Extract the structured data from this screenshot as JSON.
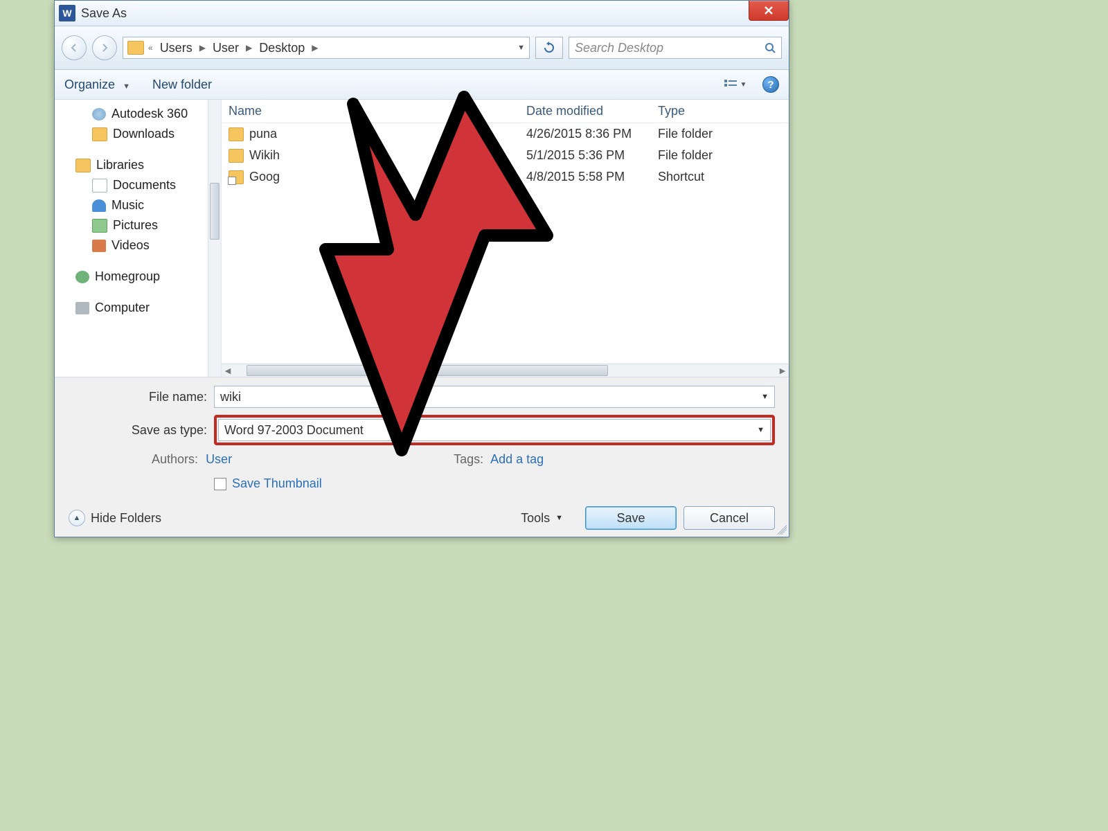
{
  "window": {
    "title": "Save As"
  },
  "breadcrumb": {
    "prefix": "«",
    "items": [
      "Users",
      "User",
      "Desktop"
    ]
  },
  "search": {
    "placeholder": "Search Desktop"
  },
  "toolbar": {
    "organize": "Organize",
    "newfolder": "New folder"
  },
  "sidebar": {
    "items": [
      {
        "label": "Autodesk 360",
        "icon": "cloud",
        "indent": 1
      },
      {
        "label": "Downloads",
        "icon": "dl",
        "indent": 1
      },
      {
        "sep": true
      },
      {
        "label": "Libraries",
        "icon": "lib",
        "indent": 0
      },
      {
        "label": "Documents",
        "icon": "doc",
        "indent": 1
      },
      {
        "label": "Music",
        "icon": "music",
        "indent": 1
      },
      {
        "label": "Pictures",
        "icon": "pic",
        "indent": 1
      },
      {
        "label": "Videos",
        "icon": "vid",
        "indent": 1
      },
      {
        "sep": true
      },
      {
        "label": "Homegroup",
        "icon": "home",
        "indent": 0
      },
      {
        "sep": true
      },
      {
        "label": "Computer",
        "icon": "comp",
        "indent": 0
      }
    ]
  },
  "columns": {
    "name": "Name",
    "date": "Date modified",
    "type": "Type"
  },
  "files": [
    {
      "name": "puna",
      "date": "4/26/2015 8:36 PM",
      "type": "File folder",
      "icon": "folder"
    },
    {
      "name": "Wikih",
      "date": "5/1/2015 5:36 PM",
      "type": "File folder",
      "icon": "folder"
    },
    {
      "name": "Goog",
      "date": "4/8/2015 5:58 PM",
      "type": "Shortcut",
      "icon": "shortcut"
    }
  ],
  "form": {
    "filename_label": "File name:",
    "filename_value": "wiki",
    "type_label": "Save as type:",
    "type_value": "Word 97-2003 Document",
    "authors_label": "Authors:",
    "authors_value": "User",
    "tags_label": "Tags:",
    "tags_value": "Add a tag",
    "thumb_label": "Save Thumbnail"
  },
  "footer": {
    "hide": "Hide Folders",
    "tools": "Tools",
    "save": "Save",
    "cancel": "Cancel"
  }
}
